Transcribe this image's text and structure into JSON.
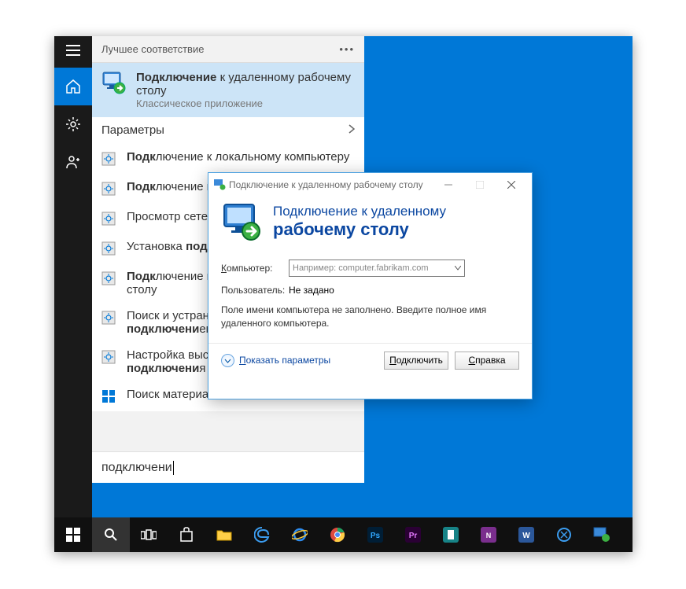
{
  "colors": {
    "accent": "#0078d7"
  },
  "start": {
    "header_label": "Лучшее соответствие",
    "best_match": {
      "title_bold": "Подключение",
      "title_rest": " к удаленному рабочему столу",
      "subtitle": "Классическое приложение"
    },
    "params_label": "Параметры",
    "items": [
      {
        "pre": "",
        "bold": "Подк",
        "rest_cut": "лючение к локальному компьютеру"
      },
      {
        "pre": "",
        "bold": "Подк",
        "rest_cut": "лючение к рабочему домену"
      },
      {
        "pre": "Просмотр сетевых ",
        "bold": "подк",
        "rest_cut": "лючений"
      },
      {
        "pre": "Установка ",
        "bold": "подключени",
        "rest_cut": "я"
      },
      {
        "pre": "",
        "bold": "Подк",
        "rest_cut": "лючение к удаленному рабочему столу"
      },
      {
        "pre": "Поиск и устранение проблем с сетью и ",
        "bold": "подключени",
        "rest_cut": "ем"
      },
      {
        "pre": "Настройка высокоскоростного ",
        "bold": "подключени",
        "rest_cut": "я"
      }
    ],
    "store_label": "Поиск материалов",
    "search_value": "подключени"
  },
  "rdp": {
    "title": "Подключение к удаленному рабочему столу",
    "banner_l1": "Подключение к удаленному",
    "banner_l2": "рабочему столу",
    "computer_label_u": "К",
    "computer_label_rest": "омпьютер:",
    "computer_placeholder": "Например: computer.fabrikam.com",
    "user_label": "Пользователь:",
    "user_value": "Не задано",
    "note": "Поле имени компьютера не заполнено. Введите полное имя удаленного компьютера.",
    "show_opts_u": "П",
    "show_opts_rest": "оказать параметры",
    "connect_u": "П",
    "connect_rest": "одключить",
    "help_u": "С",
    "help_rest": "правка"
  }
}
